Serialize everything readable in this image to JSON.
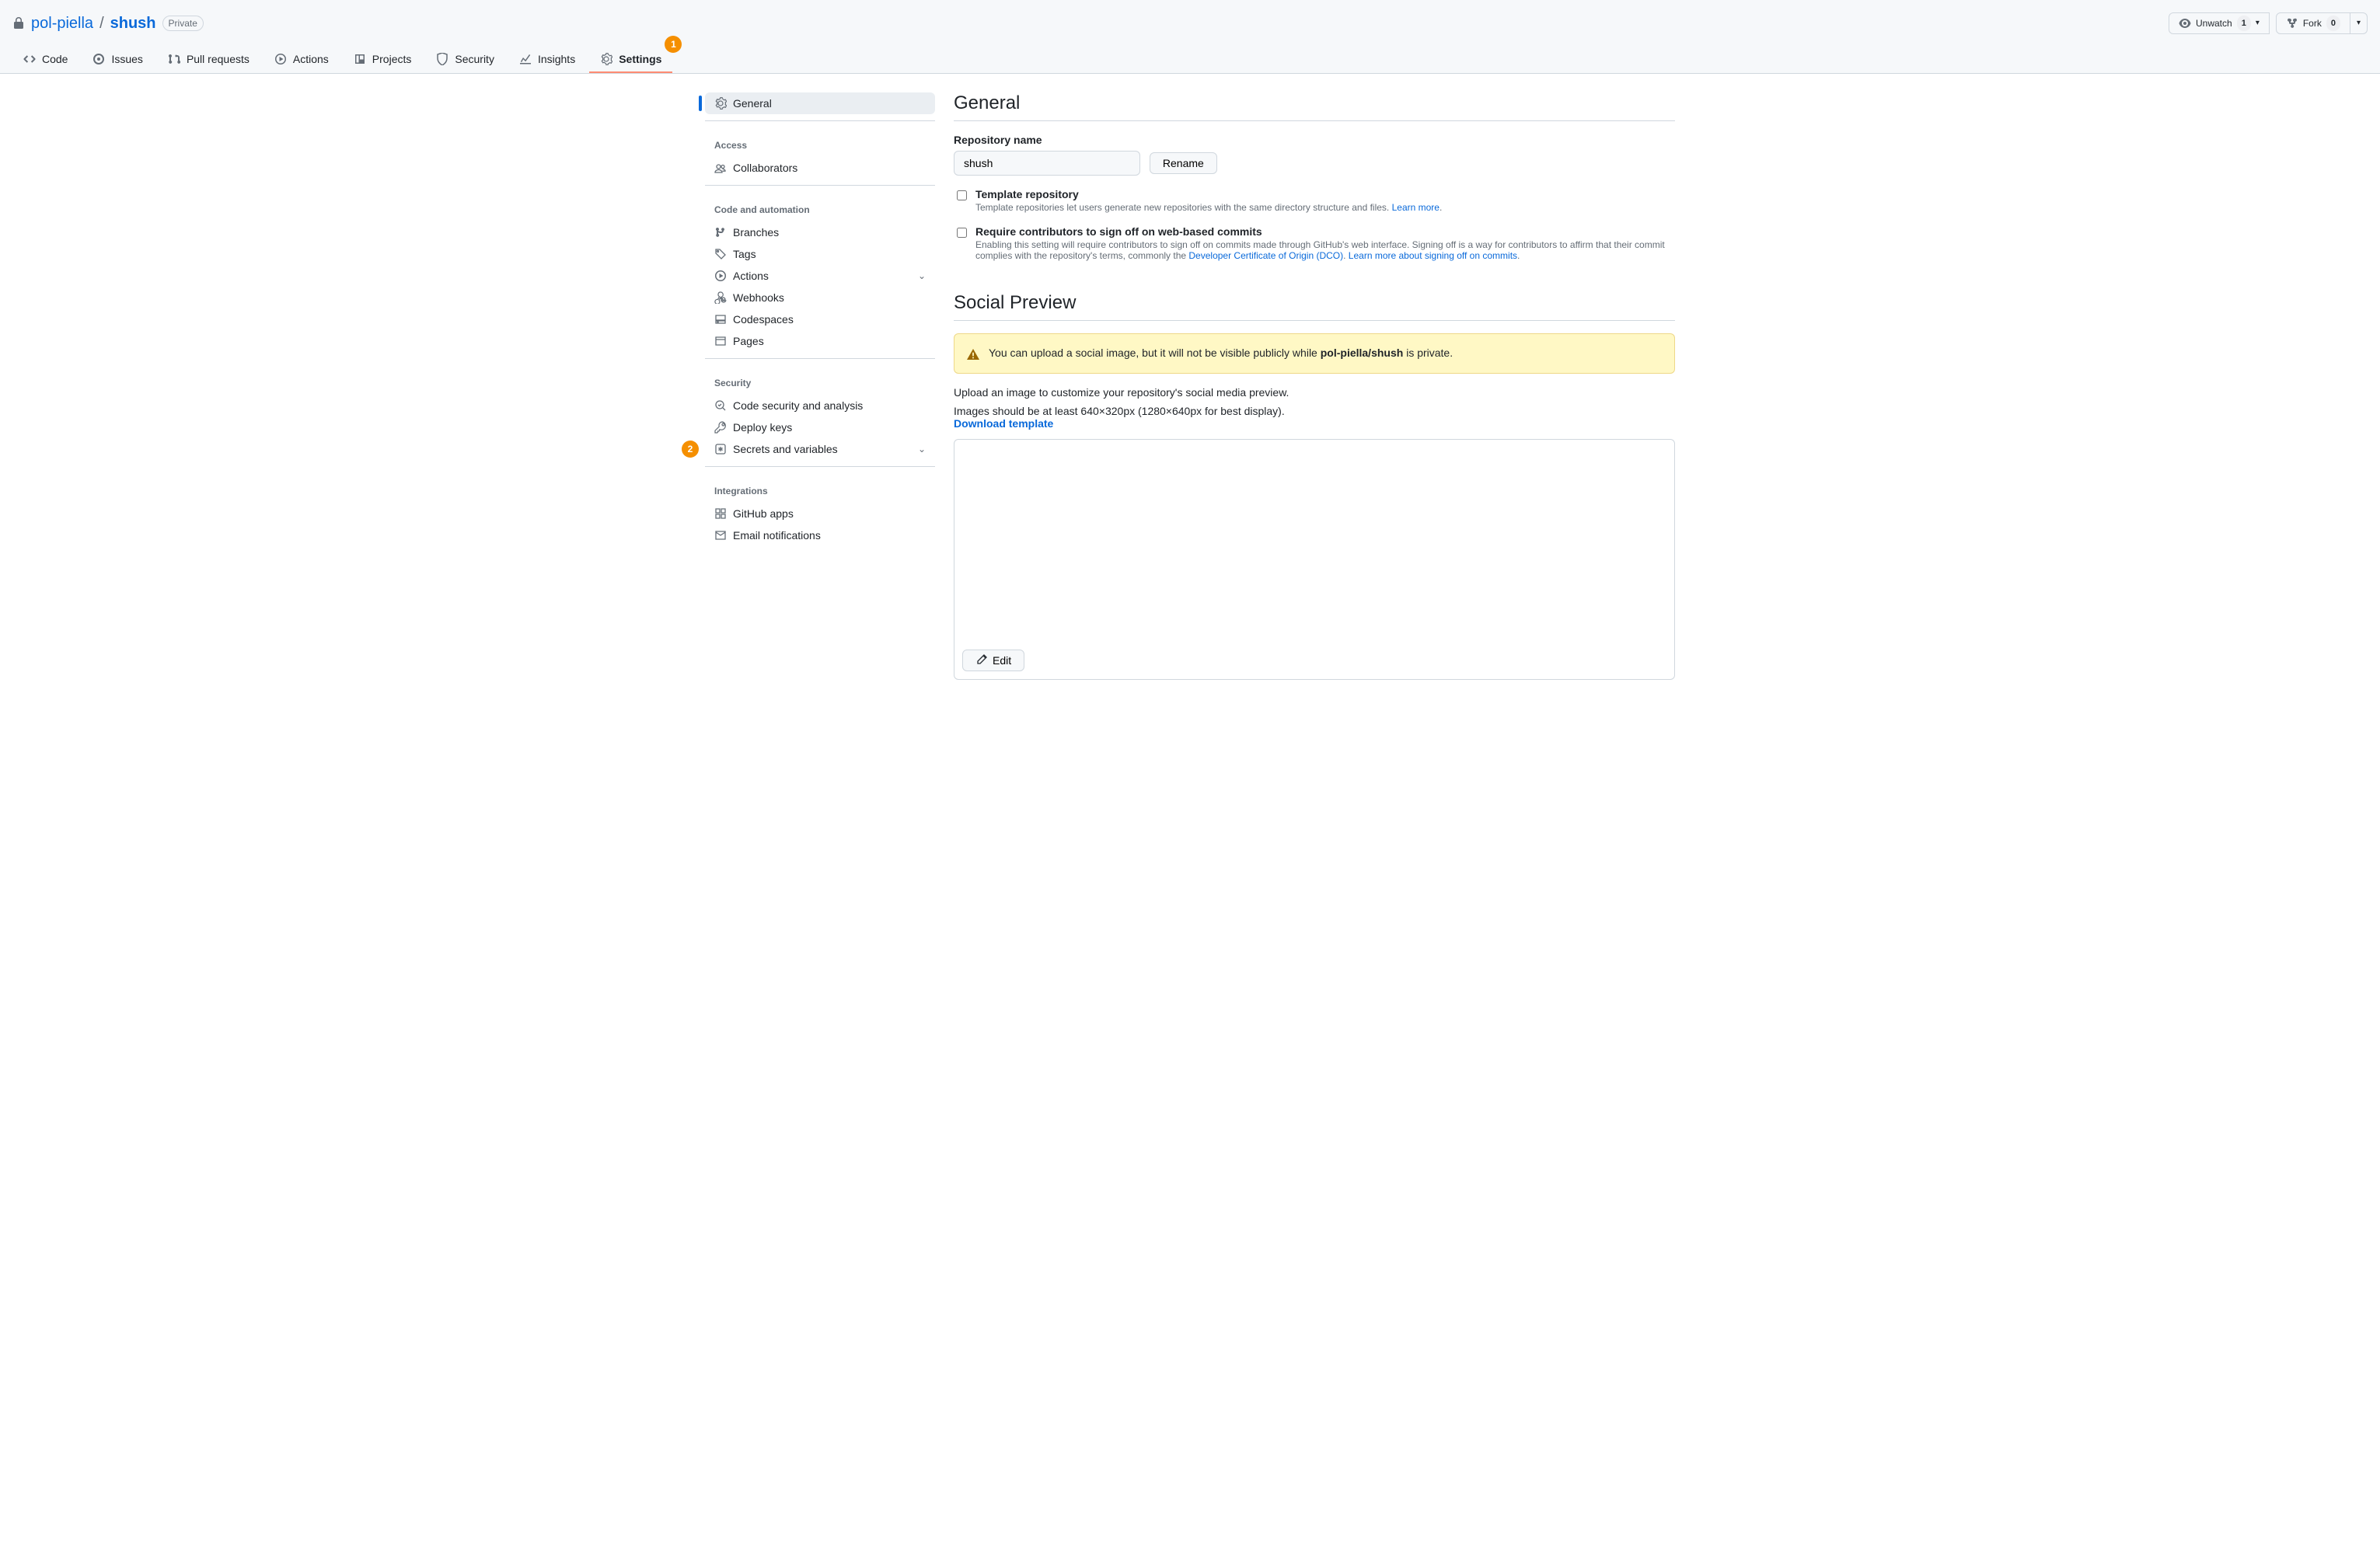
{
  "header": {
    "owner": "pol-piella",
    "repo": "shush",
    "visibility": "Private",
    "actions": {
      "unwatch_label": "Unwatch",
      "unwatch_count": "1",
      "fork_label": "Fork",
      "fork_count": "0"
    }
  },
  "tabs": {
    "code": "Code",
    "issues": "Issues",
    "pulls": "Pull requests",
    "actions": "Actions",
    "projects": "Projects",
    "security": "Security",
    "insights": "Insights",
    "settings": "Settings"
  },
  "callouts": {
    "settings": "1",
    "secrets": "2"
  },
  "sidebar": {
    "general": "General",
    "access_title": "Access",
    "collaborators": "Collaborators",
    "code_title": "Code and automation",
    "branches": "Branches",
    "tags": "Tags",
    "actions": "Actions",
    "webhooks": "Webhooks",
    "codespaces": "Codespaces",
    "pages": "Pages",
    "security_title": "Security",
    "code_sec": "Code security and analysis",
    "deploy_keys": "Deploy keys",
    "secrets": "Secrets and variables",
    "integrations_title": "Integrations",
    "gh_apps": "GitHub apps",
    "email": "Email notifications"
  },
  "general": {
    "heading": "General",
    "repo_name_label": "Repository name",
    "repo_name_value": "shush",
    "rename_label": "Rename",
    "template_title": "Template repository",
    "template_desc": "Template repositories let users generate new repositories with the same directory structure and files. ",
    "template_learn": "Learn more",
    "signoff_title": "Require contributors to sign off on web-based commits",
    "signoff_desc_a": "Enabling this setting will require contributors to sign off on commits made through GitHub's web interface. Signing off is a way for contributors to affirm that their commit complies with the repository's terms, commonly the ",
    "signoff_dco": "Developer Certificate of Origin (DCO)",
    "signoff_desc_b": ". ",
    "signoff_learn": "Learn more about signing off on commits",
    "dot": "."
  },
  "social": {
    "heading": "Social Preview",
    "flash_a": "You can upload a social image, but it will not be visible publicly while ",
    "flash_repo": "pol-piella/shush",
    "flash_b": " is private.",
    "desc1": "Upload an image to customize your repository's social media preview.",
    "desc2": "Images should be at least 640×320px (1280×640px for best display).",
    "download": "Download template",
    "edit": "Edit"
  }
}
